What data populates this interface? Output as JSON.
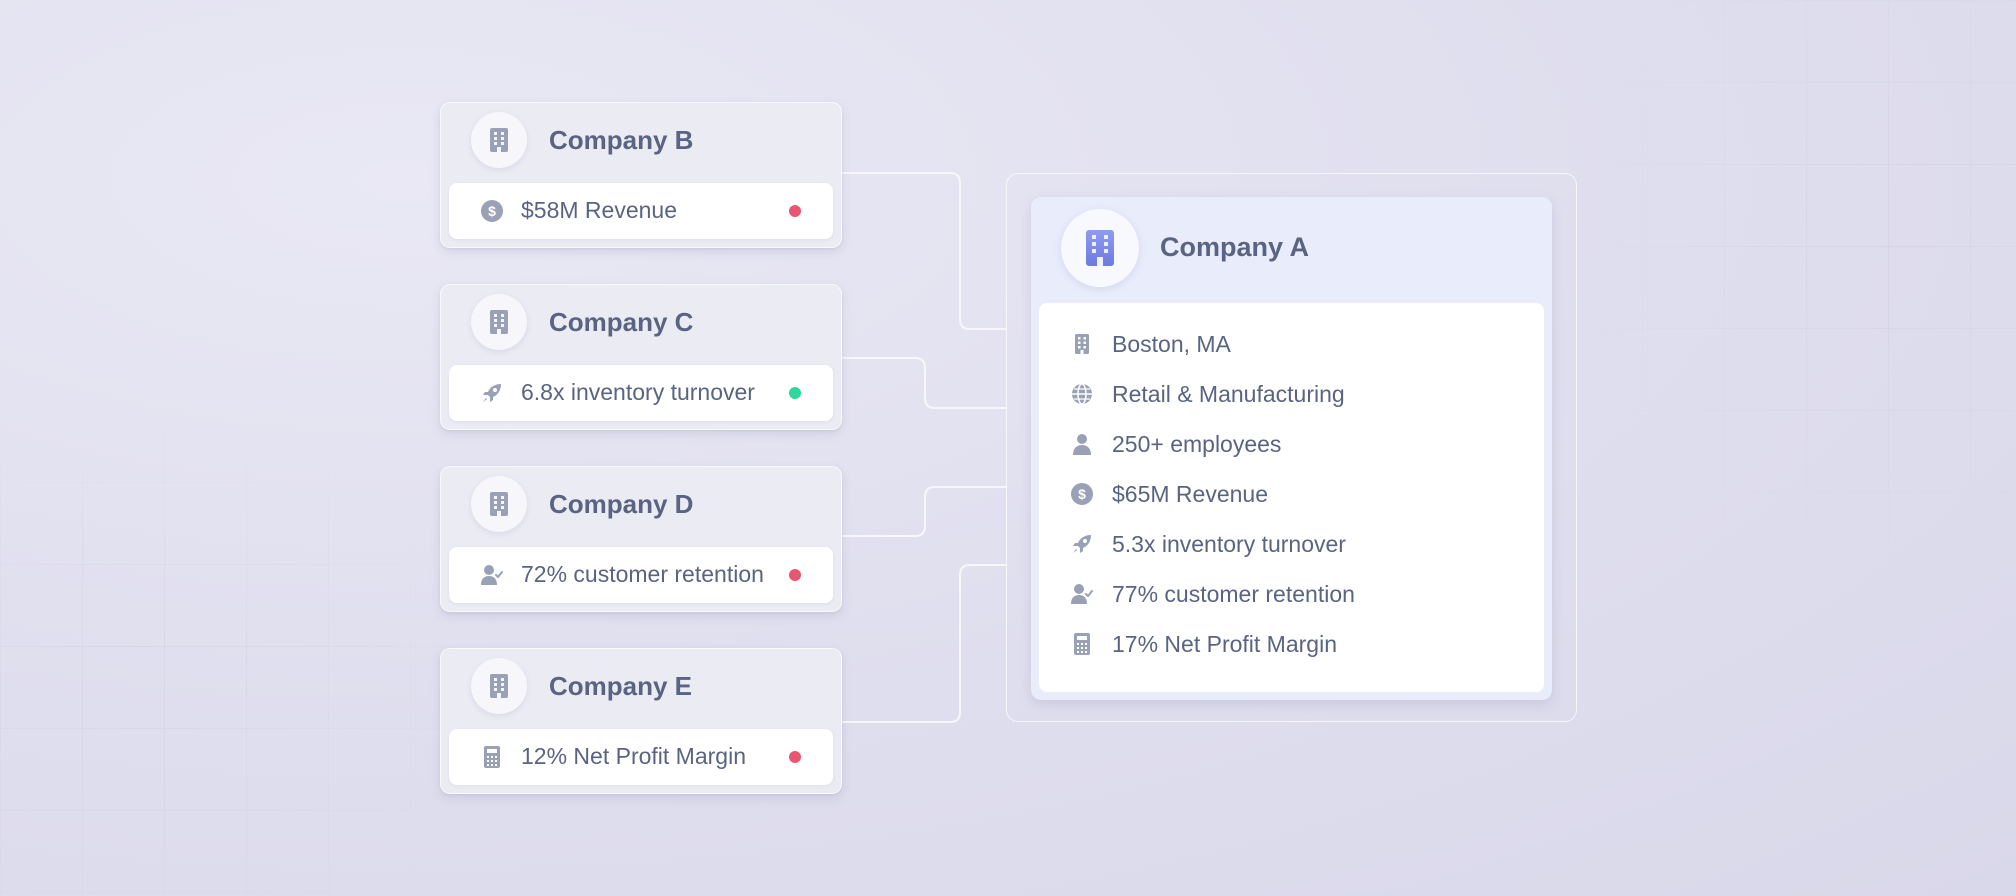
{
  "main_company": {
    "name": "Company A",
    "icon": "building-icon",
    "attributes": [
      {
        "icon": "building-icon",
        "text": "Boston, MA"
      },
      {
        "icon": "globe-icon",
        "text": "Retail & Manufacturing"
      },
      {
        "icon": "person-icon",
        "text": "250+ employees"
      },
      {
        "icon": "dollar-icon",
        "text": "$65M Revenue"
      },
      {
        "icon": "rocket-icon",
        "text": "5.3x inventory turnover"
      },
      {
        "icon": "user-check-icon",
        "text": "77% customer retention"
      },
      {
        "icon": "calculator-icon",
        "text": "17% Net Profit Margin"
      }
    ]
  },
  "comparisons": [
    {
      "name": "Company B",
      "icon": "building-icon",
      "metric_icon": "dollar-icon",
      "metric": "$58M Revenue",
      "status": "lower",
      "status_color": "#e8566f"
    },
    {
      "name": "Company C",
      "icon": "building-icon",
      "metric_icon": "rocket-icon",
      "metric": "6.8x inventory turnover",
      "status": "higher",
      "status_color": "#2fd89a"
    },
    {
      "name": "Company D",
      "icon": "building-icon",
      "metric_icon": "user-check-icon",
      "metric": "72% customer retention",
      "status": "lower",
      "status_color": "#e8566f"
    },
    {
      "name": "Company E",
      "icon": "building-icon",
      "metric_icon": "calculator-icon",
      "metric": "12% Net Profit Margin",
      "status": "lower",
      "status_color": "#e8566f"
    }
  ],
  "colors": {
    "text": "#5a6482",
    "icon_muted": "#9aa0b6",
    "icon_accent": "#7b88e6",
    "connector": "#f7f7fb",
    "positive": "#2fd89a",
    "negative": "#e8566f"
  }
}
